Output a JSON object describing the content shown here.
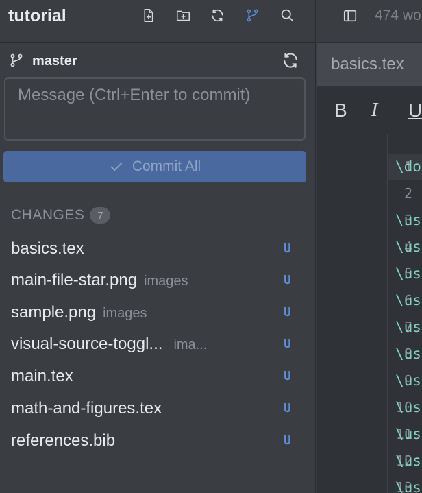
{
  "sidebar": {
    "title": "tutorial",
    "icons": [
      "new-file-icon",
      "new-folder-icon",
      "sync-icon",
      "git-branch-icon",
      "search-icon"
    ],
    "branch": "master",
    "commit_placeholder": "Message (Ctrl+Enter to commit)",
    "commit_button": "Commit All",
    "changes_label": "CHANGES",
    "changes_count": "7",
    "files": [
      {
        "name": "basics.tex",
        "dir": "",
        "status": "U"
      },
      {
        "name": "main-file-star.png",
        "dir": "images",
        "status": "U"
      },
      {
        "name": "sample.png",
        "dir": "images",
        "status": "U"
      },
      {
        "name": "visual-source-toggl...",
        "dir": "ima...",
        "status": "U"
      },
      {
        "name": "main.tex",
        "dir": "",
        "status": "U"
      },
      {
        "name": "math-and-figures.tex",
        "dir": "",
        "status": "U"
      },
      {
        "name": "references.bib",
        "dir": "",
        "status": "U"
      }
    ]
  },
  "editor": {
    "word_count": "474 wo",
    "tab_label": "basics.tex",
    "format": {
      "bold": "B",
      "italic": "I",
      "underline": "U"
    },
    "line_numbers": [
      "1",
      "2",
      "3",
      "4",
      "5",
      "6",
      "7",
      "8",
      "9",
      "10",
      "11",
      "12",
      "13"
    ],
    "code": [
      "\\do",
      "",
      "\\us",
      "\\us",
      "\\us",
      "\\us",
      "\\us",
      "\\us",
      "\\us",
      "\\us",
      "\\us",
      "\\us",
      "\\us"
    ]
  },
  "colors": {
    "background": "#3a3d42",
    "accent": "#4a6a9f",
    "status_untracked": "#5c8bd6",
    "code_keyword": "#7dd3c0"
  }
}
